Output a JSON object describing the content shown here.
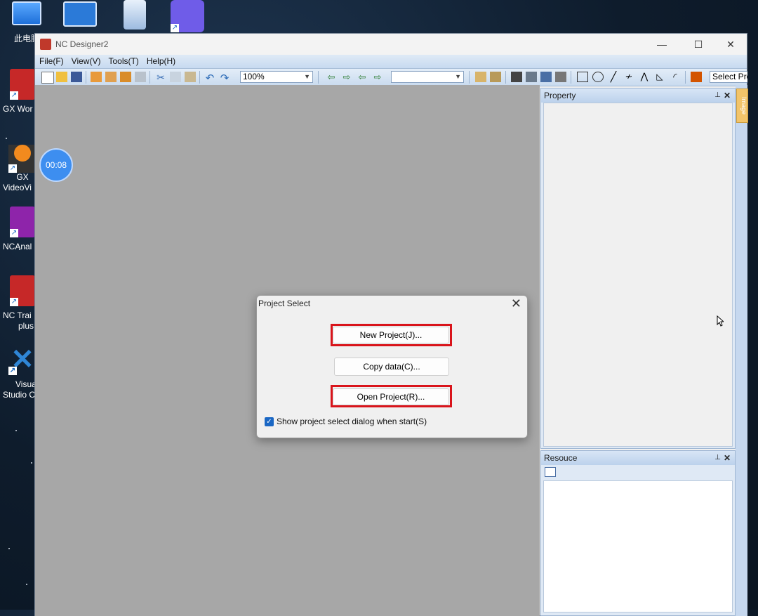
{
  "desktop": {
    "icons": [
      {
        "name": "computer",
        "label": "此电脑"
      },
      {
        "name": "gx-works",
        "label": "GX Wor"
      },
      {
        "name": "gx-videoviewer",
        "label_line1": "GX",
        "label_line2": "VideoVi"
      },
      {
        "name": "nc-analyzer",
        "label": "NCAnal"
      },
      {
        "name": "nc-trainer",
        "label_line1": "NC Trai",
        "label_line2": "plus"
      },
      {
        "name": "visual-studio",
        "label_line1": "Visua",
        "label_line2": "Studio C"
      }
    ],
    "timer": "00:08"
  },
  "window": {
    "title": "NC Designer2",
    "controls": {
      "minimize": "—",
      "maximize": "☐",
      "close": "✕"
    },
    "menu": [
      "File(F)",
      "View(V)",
      "Tools(T)",
      "Help(H)"
    ],
    "toolbar": {
      "zoom": "100%",
      "combo2": "",
      "select_label": "Select Pro"
    },
    "property_panel": {
      "title": "Property",
      "pin": "📌",
      "close": "✕"
    },
    "resource_panel": {
      "title": "Resouce",
      "pin": "📌",
      "close": "✕"
    },
    "side_tab": "Image"
  },
  "dialog": {
    "title": "Project Select",
    "close": "✕",
    "new_project": "New Project(J)...",
    "copy_data": "Copy data(C)...",
    "open_project": "Open Project(R)...",
    "checkbox_label": "Show project select dialog when start(S)",
    "checkbox_checked": true
  },
  "colors": {
    "highlight": "#d9141b",
    "accent": "#1a67c4"
  }
}
